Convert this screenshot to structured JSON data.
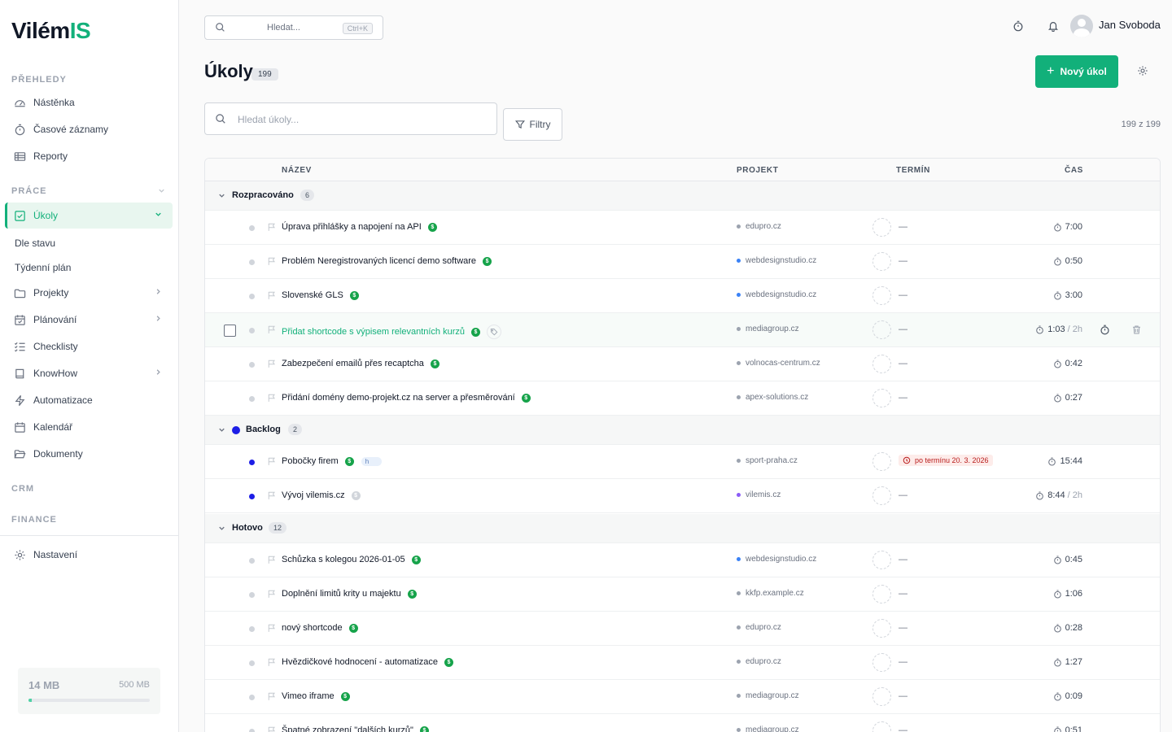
{
  "app": {
    "logo_main": "Vilém",
    "logo_accent": "IS"
  },
  "sidebar": {
    "sections": {
      "prehledy": "PŘEHLEDY",
      "prace": "PRÁCE",
      "crm": "CRM",
      "finance": "FINANCE"
    },
    "items": {
      "nastenka": "Nástěnka",
      "casove": "Časové záznamy",
      "reporty": "Reporty",
      "ukoly": "Úkoly",
      "dle_stavu": "Dle stavu",
      "tydenni": "Týdenní plán",
      "projekty": "Projekty",
      "planovani": "Plánování",
      "checklisty": "Checklisty",
      "knowhow": "KnowHow",
      "automatizace": "Automatizace",
      "kalendar": "Kalendář",
      "dokumenty": "Dokumenty",
      "nastaveni": "Nastavení"
    },
    "storage": {
      "used": "14 MB",
      "total": "500 MB",
      "used_fraction": 0.028
    }
  },
  "topbar": {
    "search_placeholder": "Hledat...",
    "shortcut": "Ctrl+K",
    "user_name": "Jan Svoboda"
  },
  "page": {
    "title": "Úkoly",
    "count": "199",
    "new_button": "Nový úkol",
    "search_placeholder": "Hledat úkoly...",
    "filter_button": "Filtry",
    "result_count": "199 z 199"
  },
  "table": {
    "headers": {
      "name": "NÁZEV",
      "project": "PROJEKT",
      "deadline": "TERMÍN",
      "time": "ČAS"
    },
    "groups": [
      {
        "name": "Rozpracováno",
        "count": "6"
      },
      {
        "name": "Backlog",
        "count": "2",
        "color": "#1d1ee6"
      },
      {
        "name": "Hotovo",
        "count": "12"
      }
    ],
    "rows": [
      {
        "name": "Úprava přihlášky a napojení na API",
        "project": "edupro.cz",
        "deadline": "—",
        "time": "7:00"
      },
      {
        "name": "Problém Neregistrovaných licencí demo software",
        "project": "webdesignstudio.cz",
        "deadline": "—",
        "time": "0:50"
      },
      {
        "name": "Slovenské GLS",
        "project": "webdesignstudio.cz",
        "deadline": "—",
        "time": "3:00"
      },
      {
        "name": "Přidat shortcode s výpisem relevantních kurzů",
        "project": "mediagroup.cz",
        "deadline": "—",
        "time": "1:03",
        "estimate": "/ 2h"
      },
      {
        "name": "Zabezpečení emailů přes recaptcha",
        "project": "volnocas-centrum.cz",
        "deadline": "—",
        "time": "0:42"
      },
      {
        "name": "Přidání domény demo-projekt.cz na server a přesměrování",
        "project": "apex-solutions.cz",
        "deadline": "—",
        "time": "0:27"
      },
      {
        "name": "Pobočky firem",
        "tag": "h",
        "project": "sport-praha.cz",
        "deadline": "po termínu 20. 3. 2026",
        "time": "15:44"
      },
      {
        "name": "Vývoj vilemis.cz",
        "project": "vilemis.cz",
        "deadline": "—",
        "time": "8:44",
        "estimate": "/ 2h"
      },
      {
        "name": "Schůzka s kolegou 2026-01-05",
        "project": "webdesignstudio.cz",
        "deadline": "—",
        "time": "0:45"
      },
      {
        "name": "Doplnění limitů krity u majektu",
        "project": "kkfp.example.cz",
        "deadline": "—",
        "time": "1:06"
      },
      {
        "name": "nový shortcode",
        "project": "edupro.cz",
        "deadline": "—",
        "time": "0:28"
      },
      {
        "name": "Hvězdičkové hodnocení - automatizace",
        "project": "edupro.cz",
        "deadline": "—",
        "time": "1:27"
      },
      {
        "name": "Vimeo iframe",
        "project": "mediagroup.cz",
        "deadline": "—",
        "time": "0:09"
      },
      {
        "name": "Špatné zobrazení \"dalších kurzů\"",
        "project": "mediagroup.cz",
        "deadline": "—",
        "time": "0:51"
      }
    ]
  },
  "colors": {
    "accent": "#12b07a",
    "backlog": "#1d1ee6",
    "project_blue": "#3b82f6",
    "project_purple": "#8b5cf6",
    "overdue_bg": "#fdecea",
    "overdue_text": "#b91c1c"
  }
}
